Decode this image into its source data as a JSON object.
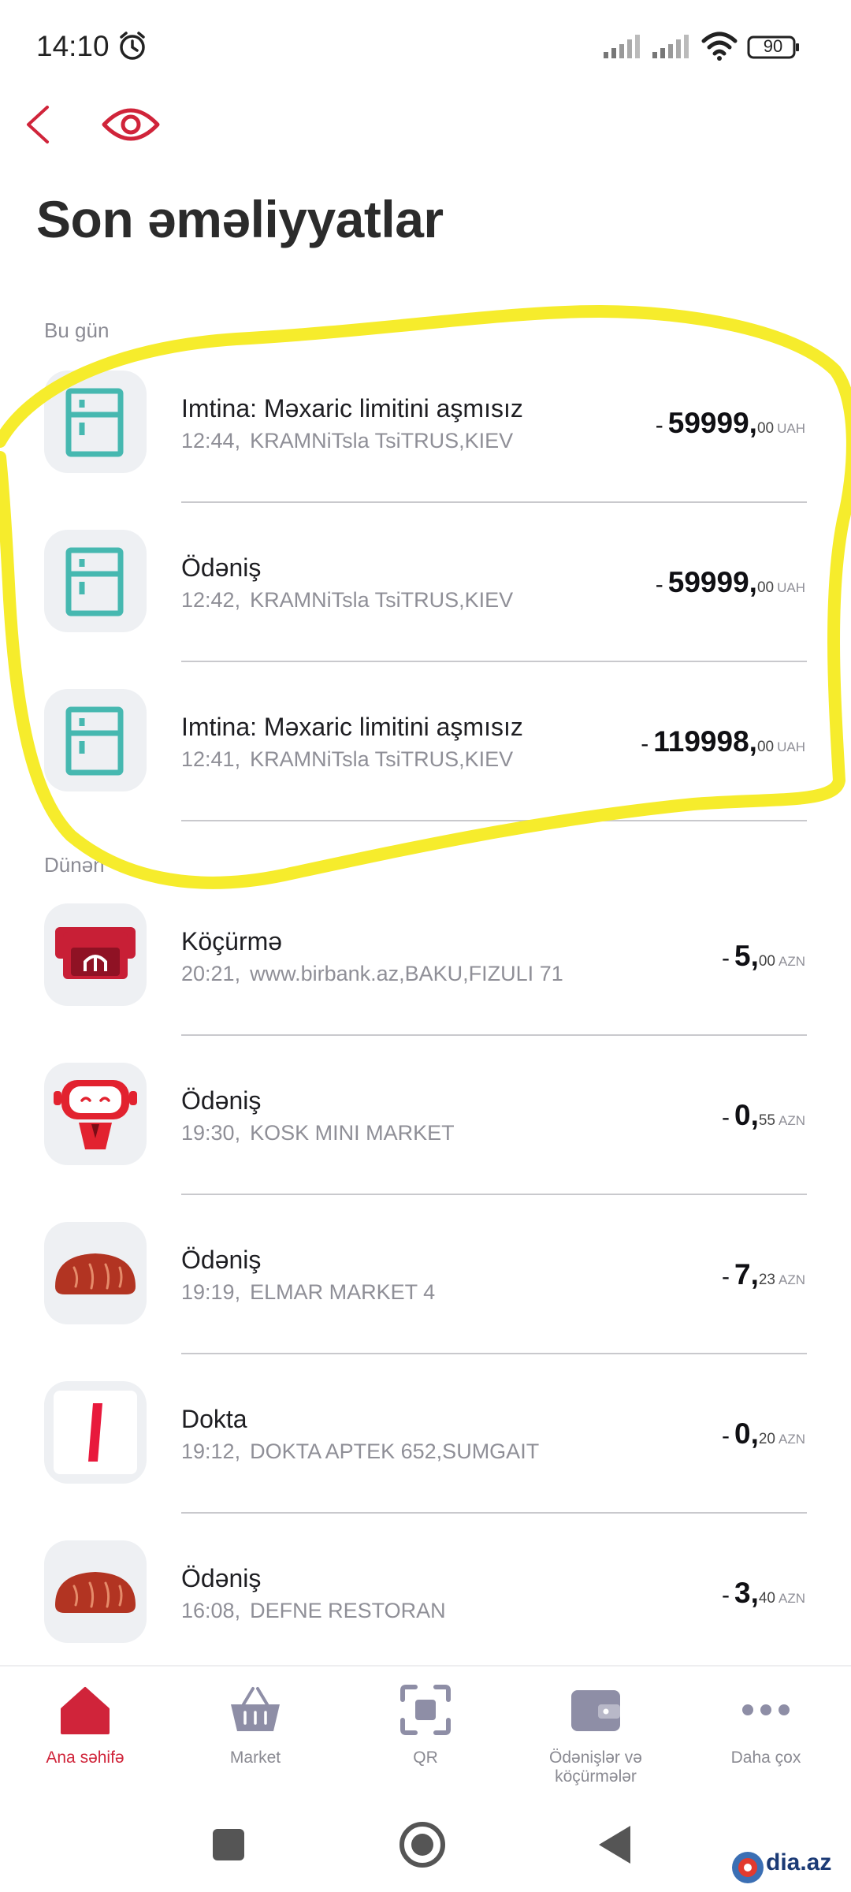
{
  "status_bar": {
    "time": "14:10",
    "battery": "90"
  },
  "header": {
    "title": "Son əməliyyatlar"
  },
  "sections": {
    "today": "Bu gün",
    "yesterday": "Dünən"
  },
  "transactions": [
    {
      "title": "Imtina: Məxaric limitini aşmısız",
      "time": "12:44,",
      "merchant": "KRAMNiTsla TsiTRUS,KIEV",
      "sign": "-",
      "whole": "59999,",
      "cents": "00",
      "currency": "UAH",
      "icon": "fridge-icon"
    },
    {
      "title": "Ödəniş",
      "time": "12:42,",
      "merchant": "KRAMNiTsla TsiTRUS,KIEV",
      "sign": "-",
      "whole": "59999,",
      "cents": "00",
      "currency": "UAH",
      "icon": "fridge-icon"
    },
    {
      "title": "Imtina: Məxaric limitini aşmısız",
      "time": "12:41,",
      "merchant": "KRAMNiTsla TsiTRUS,KIEV",
      "sign": "-",
      "whole": "119998,",
      "cents": "00",
      "currency": "UAH",
      "icon": "fridge-icon"
    },
    {
      "title": "Köçürmə",
      "time": "20:21,",
      "merchant": "www.birbank.az,BAKU,FIZULI 71",
      "sign": "-",
      "whole": "5,",
      "cents": "00",
      "currency": "AZN",
      "icon": "atm-icon"
    },
    {
      "title": "Ödəniş",
      "time": "19:30,",
      "merchant": "KOSK MINI MARKET",
      "sign": "-",
      "whole": "0,",
      "cents": "55",
      "currency": "AZN",
      "icon": "robot-icon"
    },
    {
      "title": "Ödəniş",
      "time": "19:19,",
      "merchant": "ELMAR MARKET 4",
      "sign": "-",
      "whole": "7,",
      "cents": "23",
      "currency": "AZN",
      "icon": "bread-icon"
    },
    {
      "title": "Dokta",
      "time": "19:12,",
      "merchant": "DOKTA APTEK 652,SUMGAIT",
      "sign": "-",
      "whole": "0,",
      "cents": "20",
      "currency": "AZN",
      "icon": "dokta-logo-icon"
    },
    {
      "title": "Ödəniş",
      "time": "16:08,",
      "merchant": "DEFNE RESTORAN",
      "sign": "-",
      "whole": "3,",
      "cents": "40",
      "currency": "AZN",
      "icon": "bread-icon"
    }
  ],
  "bottom_nav": [
    {
      "label": "Ana səhifə",
      "icon": "home-icon",
      "active": true
    },
    {
      "label": "Market",
      "icon": "basket-icon"
    },
    {
      "label": "QR",
      "icon": "qr-scan-icon"
    },
    {
      "label": "Ödənişlər və köçürmələr",
      "icon": "wallet-icon"
    },
    {
      "label": "Daha çox",
      "icon": "more-dots-icon"
    }
  ],
  "watermark": "dia.az",
  "colors": {
    "accent": "#d0243a",
    "teal": "#46b8b0",
    "highlight": "#f6ec2c"
  }
}
